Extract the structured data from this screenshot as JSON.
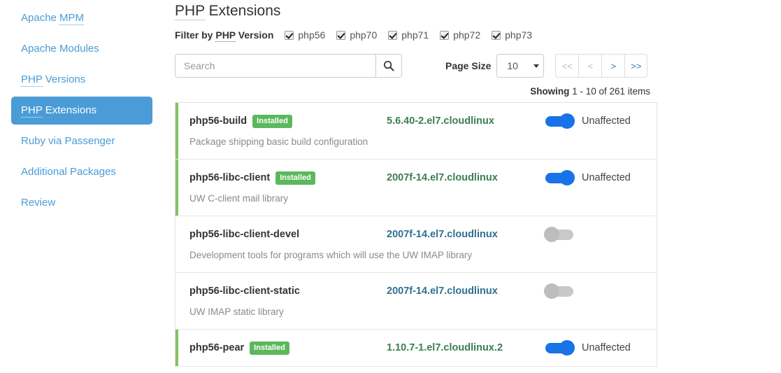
{
  "sidebar": {
    "items": [
      {
        "label": "Apache MPM",
        "abbr": "MPM",
        "prefix": "Apache ",
        "active": false
      },
      {
        "label": "Apache Modules",
        "abbr": "",
        "prefix": "Apache Modules",
        "active": false
      },
      {
        "label": "PHP Versions",
        "abbr": "PHP",
        "prefix": "",
        "suffix": " Versions",
        "active": false
      },
      {
        "label": "PHP Extensions",
        "abbr": "PHP",
        "prefix": "",
        "suffix": " Extensions",
        "active": true
      },
      {
        "label": "Ruby via Passenger",
        "abbr": "",
        "prefix": "Ruby via Passenger",
        "active": false
      },
      {
        "label": "Additional Packages",
        "abbr": "",
        "prefix": "Additional Packages",
        "active": false
      },
      {
        "label": "Review",
        "abbr": "",
        "prefix": "Review",
        "active": false
      }
    ]
  },
  "main": {
    "title_abbr": "PHP",
    "title_rest": " Extensions",
    "filter": {
      "label_prefix": "Filter by ",
      "label_abbr": "PHP",
      "label_suffix": " Version",
      "versions": [
        {
          "label": "php56",
          "checked": true
        },
        {
          "label": "php70",
          "checked": true
        },
        {
          "label": "php71",
          "checked": true
        },
        {
          "label": "php72",
          "checked": true
        },
        {
          "label": "php73",
          "checked": true
        }
      ]
    },
    "search": {
      "placeholder": "Search",
      "value": "",
      "icon": "search-icon"
    },
    "pagination": {
      "page_size_label": "Page Size",
      "page_size_value": "10",
      "buttons": [
        {
          "label": "<<",
          "name": "first-page-button",
          "disabled": true
        },
        {
          "label": "<",
          "name": "prev-page-button",
          "disabled": true
        },
        {
          "label": ">",
          "name": "next-page-button",
          "disabled": false
        },
        {
          "label": ">>",
          "name": "last-page-button",
          "disabled": false
        }
      ],
      "showing_bold": "Showing",
      "showing_text": " 1 - 10 of 261 items"
    },
    "packages": [
      {
        "name": "php56-build",
        "badge": "Installed",
        "installed": true,
        "version": "5.6.40-2.el7.cloudlinux",
        "toggle_on": true,
        "toggle_label": "Unaffected",
        "description": "Package shipping basic build configuration"
      },
      {
        "name": "php56-libc-client",
        "badge": "Installed",
        "installed": true,
        "version": "2007f-14.el7.cloudlinux",
        "toggle_on": true,
        "toggle_label": "Unaffected",
        "description": "UW C-client mail library"
      },
      {
        "name": "php56-libc-client-devel",
        "badge": "",
        "installed": false,
        "version": "2007f-14.el7.cloudlinux",
        "toggle_on": false,
        "toggle_label": "",
        "description": "Development tools for programs which will use the UW IMAP library"
      },
      {
        "name": "php56-libc-client-static",
        "badge": "",
        "installed": false,
        "version": "2007f-14.el7.cloudlinux",
        "toggle_on": false,
        "toggle_label": "",
        "description": "UW IMAP static library"
      },
      {
        "name": "php56-pear",
        "badge": "Installed",
        "installed": true,
        "version": "1.10.7-1.el7.cloudlinux.2",
        "toggle_on": true,
        "toggle_label": "Unaffected",
        "description": ""
      }
    ]
  },
  "colors": {
    "sidebar_link": "#4a9cd6",
    "sidebar_active_bg": "#4a9cd6",
    "badge_green": "#5cb85c",
    "installed_border": "#84c361",
    "installed_version": "#3c7d52",
    "version_link": "#31708f",
    "toggle_on": "#1872e8",
    "toggle_off": "#bdbdbd",
    "pager_active": "#337ab7",
    "pager_disabled": "#bbbbbb"
  }
}
